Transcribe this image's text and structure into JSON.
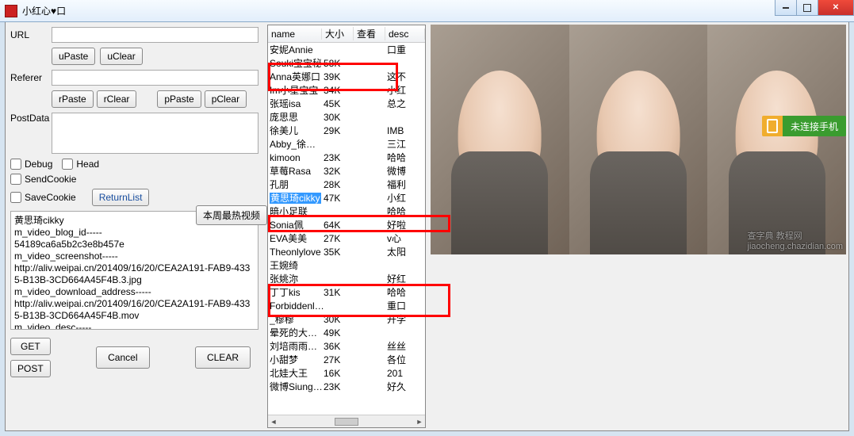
{
  "window": {
    "title": "小红心♥口"
  },
  "left": {
    "url_label": "URL",
    "referer_label": "Referer",
    "postdata_label": "PostData",
    "upaste": "uPaste",
    "uclear": "uClear",
    "rpaste": "rPaste",
    "rclear": "rClear",
    "ppaste": "pPaste",
    "pclear": "pClear",
    "debug": "Debug",
    "head": "Head",
    "sendcookie": "SendCookie",
    "savecookie": "SaveCookie",
    "returnlist": "ReturnList",
    "get": "GET",
    "post": "POST",
    "cancel": "Cancel",
    "clear": "CLEAR",
    "output": "黄思琦cikky\nm_video_blog_id-----\n54189ca6a5b2c3e8b457e\nm_video_screenshot-----\nhttp://aliv.weipai.cn/201409/16/20/CEA2A191-FAB9-4335-B13B-3CD664A45F4B.3.jpg\nm_video_download_address-----\nhttp://aliv.weipai.cn/201409/16/20/CEA2A191-FAB9-4335-B13B-3CD664A45F4B.mov\nm_video_desc-----\n小红心口口"
  },
  "mid": {
    "hot_button": "本周最热视频",
    "cols": {
      "name": "name",
      "size": "大小",
      "view": "查看",
      "desc": "desc"
    },
    "rows": [
      {
        "name": "安妮Annie",
        "size": "",
        "desc": "口重"
      },
      {
        "name": "Souki宝宝秘",
        "size": "58K",
        "desc": ""
      },
      {
        "name": "Anna英娜口",
        "size": "39K",
        "desc": "这不"
      },
      {
        "name": "Im小星宝宝",
        "size": "34K",
        "desc": "小红"
      },
      {
        "name": "张瑶isa",
        "size": "45K",
        "desc": "总之"
      },
      {
        "name": "庞思思",
        "size": "30K",
        "desc": ""
      },
      {
        "name": "徐美儿",
        "size": "29K",
        "desc": "IMB"
      },
      {
        "name": "Abby_徐…",
        "size": "",
        "desc": "三江"
      },
      {
        "name": "kimoon",
        "size": "23K",
        "desc": "哈哈"
      },
      {
        "name": "草莓Rasa",
        "size": "32K",
        "desc": "微博"
      },
      {
        "name": "孔朋",
        "size": "28K",
        "desc": "福利"
      },
      {
        "name": "黄思琦cikky",
        "size": "47K",
        "desc": "小红",
        "selected": true
      },
      {
        "name": "暗小足联",
        "size": "",
        "desc": "哈哈"
      },
      {
        "name": "Sonia佩",
        "size": "64K",
        "desc": "好啦"
      },
      {
        "name": "EVA美美",
        "size": "27K",
        "desc": "v心"
      },
      {
        "name": "Theonlylove",
        "size": "35K",
        "desc": "太阳"
      },
      {
        "name": "王婉绮",
        "size": "",
        "desc": ""
      },
      {
        "name": "张姚沵",
        "size": "",
        "desc": "好红"
      },
      {
        "name": "丁丁kis",
        "size": "31K",
        "desc": "哈哈"
      },
      {
        "name": "Forbiddenl…",
        "size": "",
        "desc": "重口"
      },
      {
        "name": "_穆穆",
        "size": "30K",
        "desc": "开学"
      },
      {
        "name": "晕死的大…",
        "size": "49K",
        "desc": ""
      },
      {
        "name": "刘培雨雨…",
        "size": "36K",
        "desc": "丝丝"
      },
      {
        "name": "小甜梦",
        "size": "27K",
        "desc": "各位"
      },
      {
        "name": "北娃大王",
        "size": "16K",
        "desc": "201"
      },
      {
        "name": "微博Siung…",
        "size": "23K",
        "desc": "好久"
      }
    ]
  },
  "right": {
    "watermark1": "查字典 教程网",
    "watermark2": "jiaocheng.chazidian.com",
    "conn_label": "未连接手机"
  }
}
